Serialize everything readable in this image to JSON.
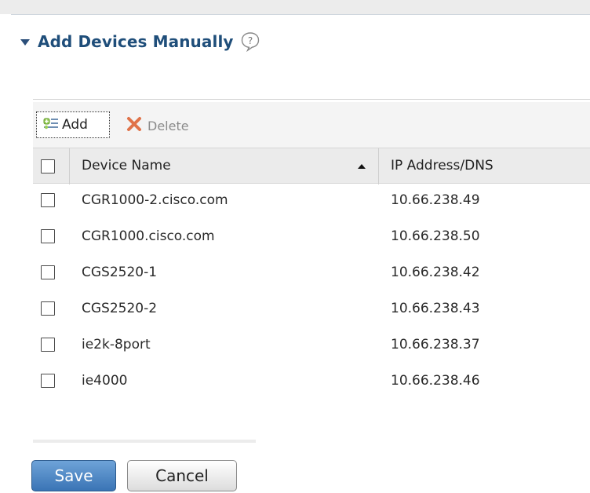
{
  "section": {
    "title": "Add Devices Manually",
    "help_icon": "question-mark-speech-bubble-icon"
  },
  "toolbar": {
    "add_label": "Add",
    "add_icon": "add-list-icon",
    "delete_label": "Delete",
    "delete_icon": "red-x-icon"
  },
  "table": {
    "columns": [
      "Device Name",
      "IP Address/DNS"
    ],
    "sort": {
      "column": "Device Name",
      "direction": "ascending"
    },
    "rows": [
      {
        "name": "CGR1000-2.cisco.com",
        "ip": "10.66.238.49",
        "checked": false
      },
      {
        "name": "CGR1000.cisco.com",
        "ip": "10.66.238.50",
        "checked": false
      },
      {
        "name": "CGS2520-1",
        "ip": "10.66.238.42",
        "checked": false
      },
      {
        "name": "CGS2520-2",
        "ip": "10.66.238.43",
        "checked": false
      },
      {
        "name": "ie2k-8port",
        "ip": "10.66.238.37",
        "checked": false
      },
      {
        "name": "ie4000",
        "ip": "10.66.238.46",
        "checked": false
      }
    ]
  },
  "footer": {
    "save_label": "Save",
    "cancel_label": "Cancel"
  },
  "colors": {
    "title": "#1f4e7a",
    "save_button": "#3a74b5",
    "delete_icon": "#e0734a"
  }
}
